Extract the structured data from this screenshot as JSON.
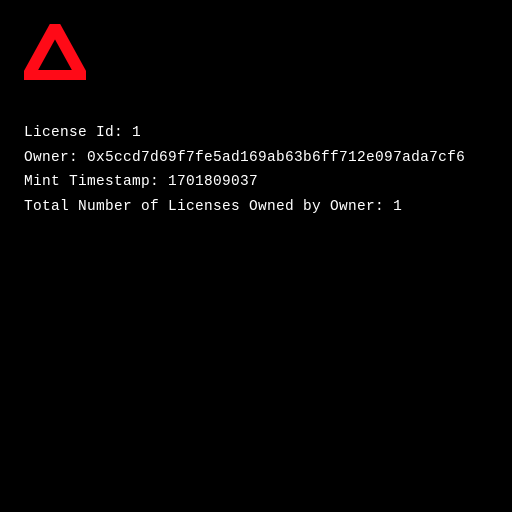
{
  "logo": {
    "color": "#ff0a17"
  },
  "info": {
    "license_id_label": "License Id: ",
    "license_id_value": "1",
    "owner_label": "Owner: ",
    "owner_value": "0x5ccd7d69f7fe5ad169ab63b6ff712e097ada7cf6",
    "mint_ts_label": "Mint Timestamp: ",
    "mint_ts_value": "1701809037",
    "total_label": "Total Number of Licenses Owned by Owner: ",
    "total_value": "1"
  }
}
